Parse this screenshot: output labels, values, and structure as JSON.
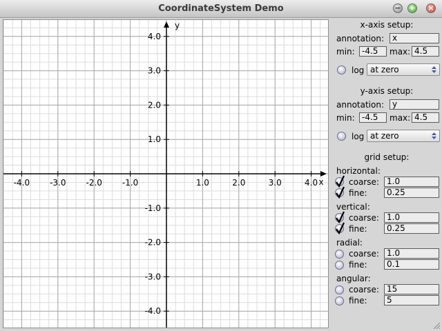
{
  "window": {
    "title": "CoordinateSystem Demo",
    "min_symbol": "−",
    "max_symbol": "+",
    "close_symbol": "×"
  },
  "plot": {
    "x_label": "x",
    "y_label": "y",
    "x_ticks": [
      "-4.0",
      "-3.0",
      "-2.0",
      "-1.0",
      "1.0",
      "2.0",
      "3.0",
      "4.0"
    ],
    "y_ticks": [
      "4.0",
      "3.0",
      "2.0",
      "1.0",
      "-1.0",
      "-2.0",
      "-3.0",
      "-4.0"
    ],
    "x_range": [
      -4.5,
      4.5
    ],
    "y_range": [
      -4.5,
      4.5
    ],
    "coarse_step": 1.0,
    "fine_step": 0.25
  },
  "xaxis": {
    "title": "x-axis setup:",
    "annotation_label": "annotation:",
    "annotation_value": "x",
    "min_label": "min:",
    "min_value": "-4.5",
    "max_label": "max:",
    "max_value": "4.5",
    "log_label": "log",
    "log_checked": false,
    "position_value": "at zero"
  },
  "yaxis": {
    "title": "y-axis setup:",
    "annotation_label": "annotation:",
    "annotation_value": "y",
    "min_label": "min:",
    "min_value": "-4.5",
    "max_label": "max:",
    "max_value": "4.5",
    "log_label": "log",
    "log_checked": false,
    "position_value": "at zero"
  },
  "grid": {
    "title": "grid setup:",
    "coarse_label": "coarse:",
    "fine_label": "fine:",
    "horizontal": {
      "label": "horizontal:",
      "coarse_checked": true,
      "coarse_value": "1.0",
      "fine_checked": true,
      "fine_value": "0.25"
    },
    "vertical": {
      "label": "vertical:",
      "coarse_checked": true,
      "coarse_value": "1.0",
      "fine_checked": true,
      "fine_value": "0.25"
    },
    "radial": {
      "label": "radial:",
      "coarse_checked": false,
      "coarse_value": "1.0",
      "fine_checked": false,
      "fine_value": "0.1"
    },
    "angular": {
      "label": "angular:",
      "coarse_checked": false,
      "coarse_value": "15",
      "fine_checked": false,
      "fine_value": "5"
    }
  }
}
